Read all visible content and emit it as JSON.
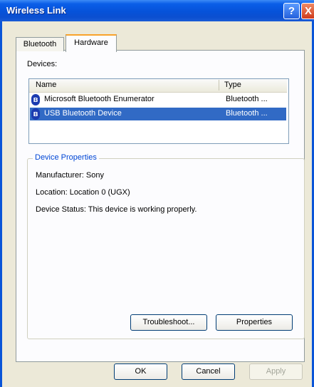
{
  "window": {
    "title": "Wireless Link"
  },
  "title_buttons": {
    "help": "?",
    "close": "X"
  },
  "tabs": [
    {
      "label": "Bluetooth",
      "selected": false
    },
    {
      "label": "Hardware",
      "selected": true
    }
  ],
  "devices": {
    "label": "Devices:",
    "columns": [
      "Name",
      "Type"
    ],
    "rows": [
      {
        "name": "Microsoft Bluetooth Enumerator",
        "type": "Bluetooth ...",
        "selected": false
      },
      {
        "name": "USB Bluetooth Device",
        "type": "Bluetooth ...",
        "selected": true
      }
    ]
  },
  "properties": {
    "legend": "Device Properties",
    "manufacturer": "Manufacturer: Sony",
    "location": "Location: Location 0 (UGX)",
    "status": "Device Status: This device is working properly."
  },
  "buttons": {
    "troubleshoot": "Troubleshoot...",
    "properties": "Properties",
    "ok": "OK",
    "cancel": "Cancel",
    "apply": "Apply"
  },
  "icons": {
    "device": "bluetooth-icon"
  },
  "colors": {
    "title_bar": "#0a5ee8",
    "selection": "#316ac5",
    "legend": "#0046d5",
    "active_tab_accent": "#f9a32a"
  }
}
